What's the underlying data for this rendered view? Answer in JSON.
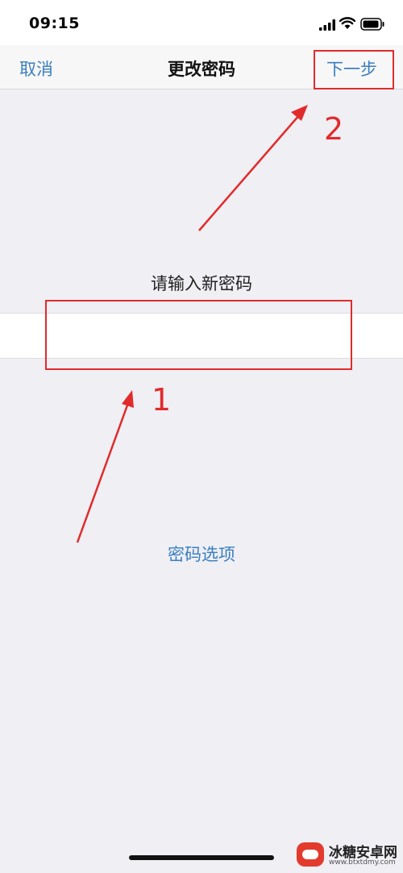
{
  "status_bar": {
    "time": "09:15",
    "icons": [
      "signal-icon",
      "wifi-icon",
      "battery-icon"
    ]
  },
  "nav_bar": {
    "cancel_label": "取消",
    "title": "更改密码",
    "next_label": "下一步"
  },
  "form": {
    "prompt": "请输入新密码",
    "password_value": "",
    "options_label": "密码选项"
  },
  "annotations": {
    "step_next": "2",
    "step_field": "1",
    "color": "#e12b2b"
  },
  "watermark": {
    "title": "冰糖安卓网",
    "url": "www.btxtdmy.com"
  },
  "colors": {
    "accent": "#3a7fc1",
    "background": "#efeff4"
  }
}
